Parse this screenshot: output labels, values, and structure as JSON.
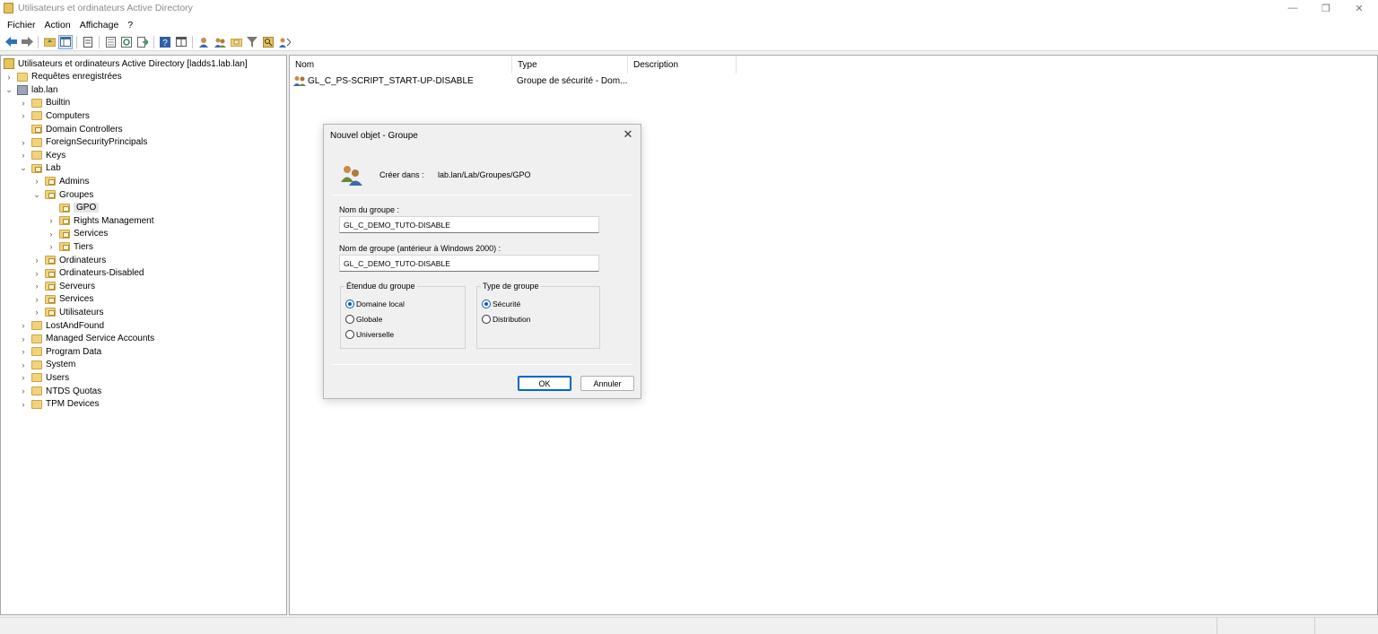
{
  "window": {
    "title": "Utilisateurs et ordinateurs Active Directory",
    "minimize_glyph": "—",
    "restore_glyph": "❐",
    "close_glyph": "✕"
  },
  "menu": [
    "Fichier",
    "Action",
    "Affichage",
    "?"
  ],
  "toolbar": {
    "icons": [
      "back-icon",
      "forward-icon",
      "up-folder-icon",
      "show-hide-tree-icon",
      "delete-icon",
      "properties-icon",
      "refresh-icon",
      "export-icon",
      "help-icon",
      "console-tree-icon",
      "new-user-icon",
      "new-group-icon",
      "new-ou-icon",
      "filter-icon",
      "find-icon",
      "add-to-group-icon"
    ]
  },
  "tree": {
    "items": [
      {
        "label": "Utilisateurs et ordinateurs Active Directory [ladds1.lab.lan]",
        "level": 0,
        "chevron": "",
        "icon": "root"
      },
      {
        "label": "Requêtes enregistrées",
        "level": 1,
        "chevron": "›",
        "icon": "folder"
      },
      {
        "label": "lab.lan",
        "level": 1,
        "chevron": "⌄",
        "icon": "domain"
      },
      {
        "label": "Builtin",
        "level": 2,
        "chevron": "›",
        "icon": "folder"
      },
      {
        "label": "Computers",
        "level": 2,
        "chevron": "›",
        "icon": "folder"
      },
      {
        "label": "Domain Controllers",
        "level": 2,
        "chevron": "",
        "icon": "ou"
      },
      {
        "label": "ForeignSecurityPrincipals",
        "level": 2,
        "chevron": "›",
        "icon": "folder"
      },
      {
        "label": "Keys",
        "level": 2,
        "chevron": "›",
        "icon": "folder"
      },
      {
        "label": "Lab",
        "level": 2,
        "chevron": "⌄",
        "icon": "ou"
      },
      {
        "label": "Admins",
        "level": 3,
        "chevron": "›",
        "icon": "ou"
      },
      {
        "label": "Groupes",
        "level": 3,
        "chevron": "⌄",
        "icon": "ou"
      },
      {
        "label": "GPO",
        "level": 4,
        "chevron": "",
        "icon": "ou",
        "selected": true
      },
      {
        "label": "Rights Management",
        "level": 4,
        "chevron": "›",
        "icon": "ou"
      },
      {
        "label": "Services",
        "level": 4,
        "chevron": "›",
        "icon": "ou"
      },
      {
        "label": "Tiers",
        "level": 4,
        "chevron": "›",
        "icon": "ou"
      },
      {
        "label": "Ordinateurs",
        "level": 3,
        "chevron": "›",
        "icon": "ou"
      },
      {
        "label": "Ordinateurs-Disabled",
        "level": 3,
        "chevron": "›",
        "icon": "ou"
      },
      {
        "label": "Serveurs",
        "level": 3,
        "chevron": "›",
        "icon": "ou"
      },
      {
        "label": "Services",
        "level": 3,
        "chevron": "›",
        "icon": "ou"
      },
      {
        "label": "Utilisateurs",
        "level": 3,
        "chevron": "›",
        "icon": "ou"
      },
      {
        "label": "LostAndFound",
        "level": 2,
        "chevron": "›",
        "icon": "folder"
      },
      {
        "label": "Managed Service Accounts",
        "level": 2,
        "chevron": "›",
        "icon": "folder"
      },
      {
        "label": "Program Data",
        "level": 2,
        "chevron": "›",
        "icon": "folder"
      },
      {
        "label": "System",
        "level": 2,
        "chevron": "›",
        "icon": "folder"
      },
      {
        "label": "Users",
        "level": 2,
        "chevron": "›",
        "icon": "folder"
      },
      {
        "label": "NTDS Quotas",
        "level": 2,
        "chevron": "›",
        "icon": "folder"
      },
      {
        "label": "TPM Devices",
        "level": 2,
        "chevron": "›",
        "icon": "folder"
      }
    ]
  },
  "list": {
    "columns": [
      "Nom",
      "Type",
      "Description"
    ],
    "rows": [
      {
        "name": "GL_C_PS-SCRIPT_START-UP-DISABLE",
        "type": "Groupe de sécurité - Dom...",
        "description": ""
      }
    ]
  },
  "dialog": {
    "title": "Nouvel objet - Groupe",
    "create_in_label": "Créer dans :",
    "create_in_value": "lab.lan/Lab/Groupes/GPO",
    "group_name_label": "Nom du groupe :",
    "group_name_value": "GL_C_DEMO_TUTO-DISABLE",
    "group_name_pre2000_label": "Nom de groupe (antérieur à Windows 2000) :",
    "group_name_pre2000_value": "GL_C_DEMO_TUTO-DISABLE",
    "scope": {
      "title": "Étendue du groupe",
      "options": [
        "Domaine local",
        "Globale",
        "Universelle"
      ],
      "selected": "Domaine local"
    },
    "type": {
      "title": "Type de groupe",
      "options": [
        "Sécurité",
        "Distribution"
      ],
      "selected": "Sécurité"
    },
    "ok_label": "OK",
    "cancel_label": "Annuler",
    "close_glyph": "✕"
  },
  "colors": {
    "folder": "#f3d27a",
    "accent": "#0067c0",
    "selection": "#e5e5e5"
  }
}
